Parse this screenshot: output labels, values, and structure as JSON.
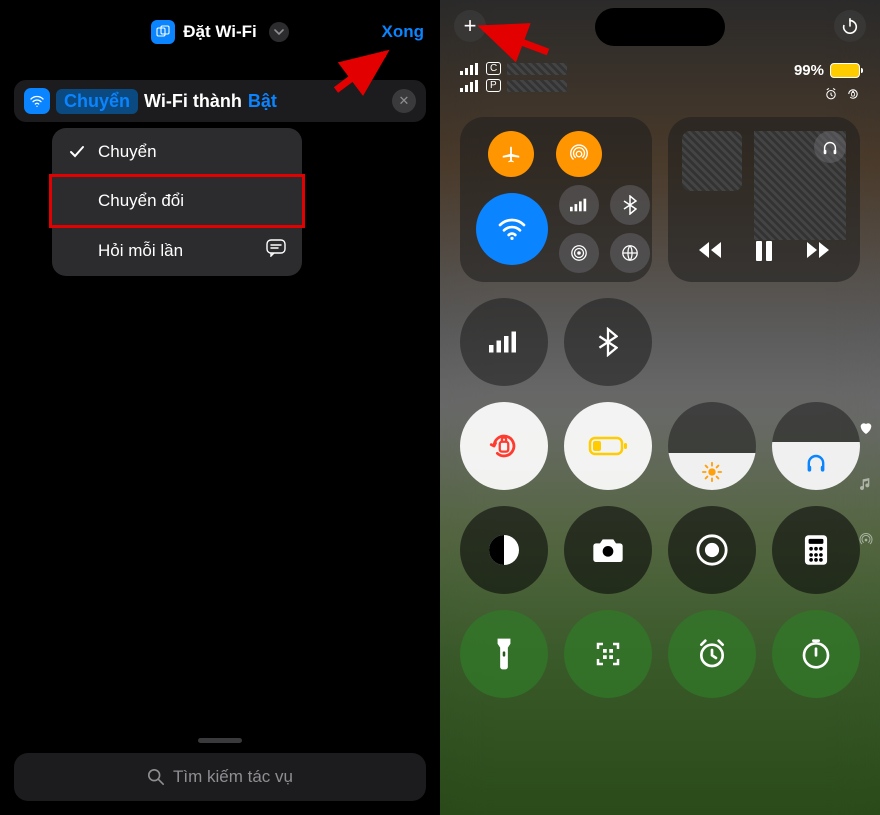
{
  "left": {
    "header_title": "Đặt Wi-Fi",
    "done": "Xong",
    "action_verb_pill": "Chuyển",
    "action_mid": "Wi-Fi thành",
    "action_state": "Bật",
    "menu": {
      "opt_turn": "Chuyển",
      "opt_toggle": "Chuyển đổi",
      "opt_ask": "Hỏi mỗi lần"
    },
    "search_placeholder": "Tìm kiếm tác vụ"
  },
  "right": {
    "battery_pct": "99%",
    "carrier_badges": [
      "C",
      "P"
    ]
  },
  "icons": {
    "plus": "+",
    "close": "✕"
  }
}
